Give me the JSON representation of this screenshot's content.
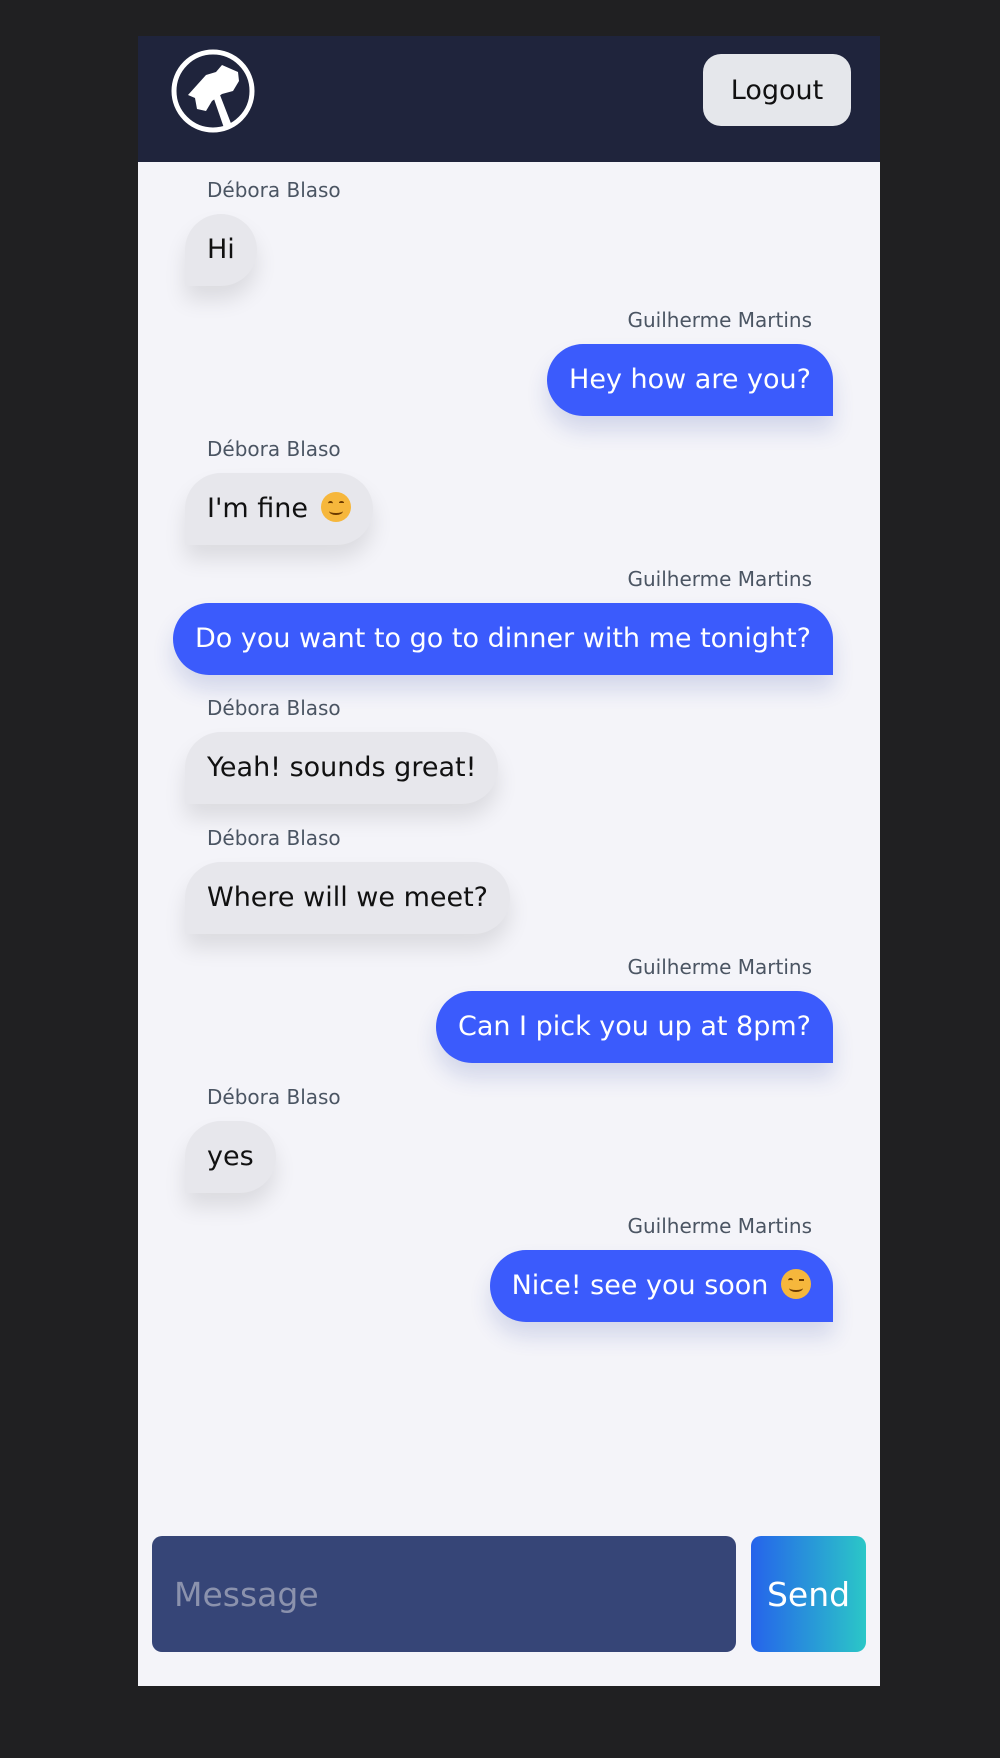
{
  "header": {
    "logo_icon": "hammer-logo-icon",
    "logout_label": "Logout"
  },
  "messages": [
    {
      "author": "Débora Blaso",
      "text": "Hi",
      "side": "received"
    },
    {
      "author": "Guilherme Martins",
      "text": "Hey how are you?",
      "side": "sent"
    },
    {
      "author": "Débora Blaso",
      "text": "I'm fine",
      "emoji": "smiling-face-icon",
      "side": "received"
    },
    {
      "author": "Guilherme Martins",
      "text": "Do you want to go to dinner with me tonight?",
      "side": "sent"
    },
    {
      "author": "Débora Blaso",
      "text": "Yeah! sounds great!",
      "side": "received"
    },
    {
      "author": "Débora Blaso",
      "text": "Where will we meet?",
      "side": "received"
    },
    {
      "author": "Guilherme Martins",
      "text": "Can I pick you up at 8pm?",
      "side": "sent"
    },
    {
      "author": "Débora Blaso",
      "text": "yes",
      "side": "received"
    },
    {
      "author": "Guilherme Martins",
      "text": "Nice! see you soon",
      "emoji": "winking-face-icon",
      "side": "sent"
    }
  ],
  "composer": {
    "placeholder": "Message",
    "value": "",
    "send_label": "Send"
  },
  "colors": {
    "page_background": "#202022",
    "header_background": "#1f243c",
    "chat_background": "#f4f4f9",
    "sent_bubble": "#3b5bfc",
    "received_bubble": "#e7e7ec",
    "input_background": "#364577",
    "send_gradient_start": "#2563eb",
    "send_gradient_end": "#2bc7c7"
  }
}
